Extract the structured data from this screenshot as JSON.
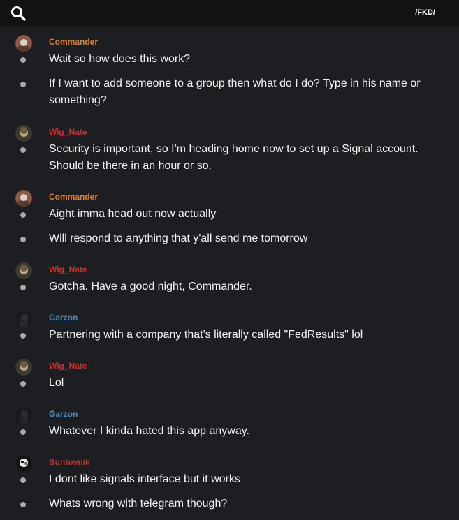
{
  "header": {
    "channel": "/FKD/",
    "search_icon": "search-icon"
  },
  "colors": {
    "Commander": "#e07f2a",
    "Wig_Nate": "#d42a2a",
    "Garzon": "#4d8fc4",
    "Buntovnik": "#c82c2c"
  },
  "groups": [
    {
      "author": "Commander",
      "messages": [
        "Wait so how does this work?",
        "If I want to add someone to a group then what do I do? Type in his name or something?"
      ]
    },
    {
      "author": "Wig_Nate",
      "messages": [
        "Security is important, so I'm heading home now to set up a Signal account. Should be there in an hour or so."
      ]
    },
    {
      "author": "Commander",
      "messages": [
        "Aight imma head out now actually",
        "Will respond to anything that y'all send me tomorrow"
      ]
    },
    {
      "author": "Wig_Nate",
      "messages": [
        "Gotcha. Have a good night, Commander."
      ]
    },
    {
      "author": "Garzon",
      "messages": [
        "Partnering with a company that's literally called \"FedResults\" lol"
      ]
    },
    {
      "author": "Wig_Nate",
      "messages": [
        "Lol"
      ]
    },
    {
      "author": "Garzon",
      "messages": [
        "Whatever I kinda hated this app anyway."
      ]
    },
    {
      "author": "Buntovnik",
      "messages": [
        "I dont like signals interface but it works",
        "Whats wrong with telegram though?"
      ]
    }
  ]
}
